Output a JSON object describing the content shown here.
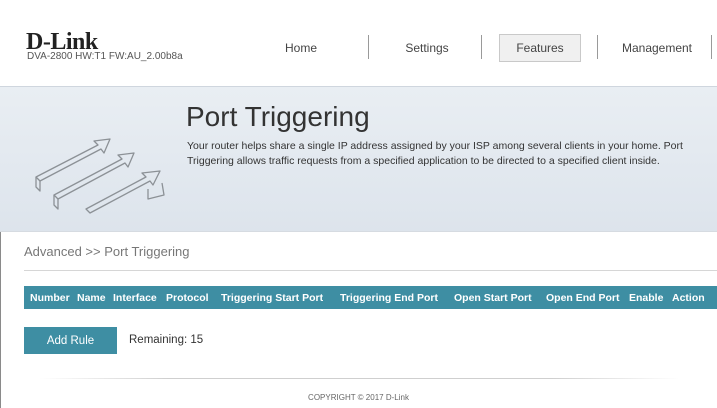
{
  "header": {
    "brand": "D-Link",
    "device_info": "DVA-2800   HW:T1   FW:AU_2.00b8a",
    "nav": [
      {
        "label": "Home",
        "active": false
      },
      {
        "label": "Settings",
        "active": false
      },
      {
        "label": "Features",
        "active": true
      },
      {
        "label": "Management",
        "active": false
      }
    ]
  },
  "banner": {
    "icon": "port-triggering-icon",
    "title": "Port Triggering",
    "description": "Your router helps share a single IP address assigned by your ISP among several clients in your home. Port Triggering allows traffic requests from a specified application to be directed to a specified client inside."
  },
  "breadcrumb": "Advanced >> Port Triggering",
  "table": {
    "columns": [
      "Number",
      "Name",
      "Interface",
      "Protocol",
      "Triggering Start Port",
      "Triggering End Port",
      "Open Start Port",
      "Open End Port",
      "Enable",
      "Action"
    ],
    "rows": []
  },
  "actions": {
    "add_rule_label": "Add Rule",
    "remaining_text": "Remaining: 15"
  },
  "footer": {
    "copyright": "COPYRIGHT © 2017 D-Link"
  },
  "colors": {
    "accent": "#3e8ea3",
    "banner_bg": "#e4eaf0"
  }
}
